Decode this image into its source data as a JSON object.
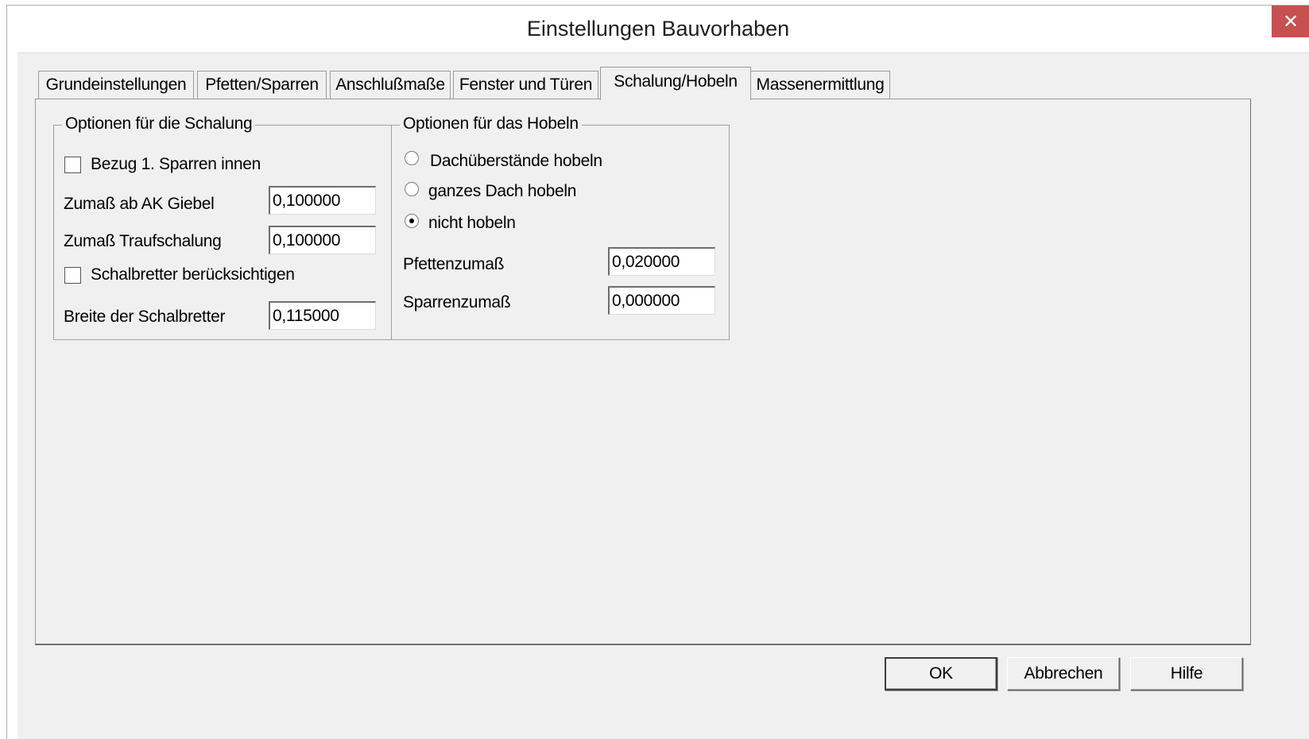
{
  "window": {
    "title": "Einstellungen Bauvorhaben",
    "close_glyph": "✕"
  },
  "tabs": [
    {
      "label": "Grundeinstellungen"
    },
    {
      "label": "Pfetten/Sparren"
    },
    {
      "label": "Anschlußmaße"
    },
    {
      "label": "Fenster und Türen"
    },
    {
      "label": "Schalung/Hobeln",
      "active": true
    },
    {
      "label": "Massenermittlung"
    }
  ],
  "schalung": {
    "caption": "Optionen für die Schalung",
    "bezug_label": "Bezug 1. Sparren innen",
    "bezug_checked": false,
    "zumass_giebel_label": "Zumaß ab AK Giebel",
    "zumass_giebel_value": "0,100000",
    "zumass_trauf_label": "Zumaß Traufschalung",
    "zumass_trauf_value": "0,100000",
    "schalbretter_label": "Schalbretter berücksichtigen",
    "schalbretter_checked": false,
    "breite_label": "Breite der Schalbretter",
    "breite_value": "0,115000"
  },
  "hobeln": {
    "caption": "Optionen für das Hobeln",
    "options": [
      {
        "label": "Dachüberstände hobeln",
        "selected": false
      },
      {
        "label": "ganzes Dach hobeln",
        "selected": false
      },
      {
        "label": "nicht hobeln",
        "selected": true
      }
    ],
    "pfetten_label": "Pfettenzumaß",
    "pfetten_value": "0,020000",
    "sparren_label": "Sparrenzumaß",
    "sparren_value": "0,000000"
  },
  "buttons": {
    "ok": "OK",
    "cancel": "Abbrechen",
    "help": "Hilfe"
  },
  "colors": {
    "close_button": "#c75050",
    "dialog_face": "#f0f0f0"
  }
}
